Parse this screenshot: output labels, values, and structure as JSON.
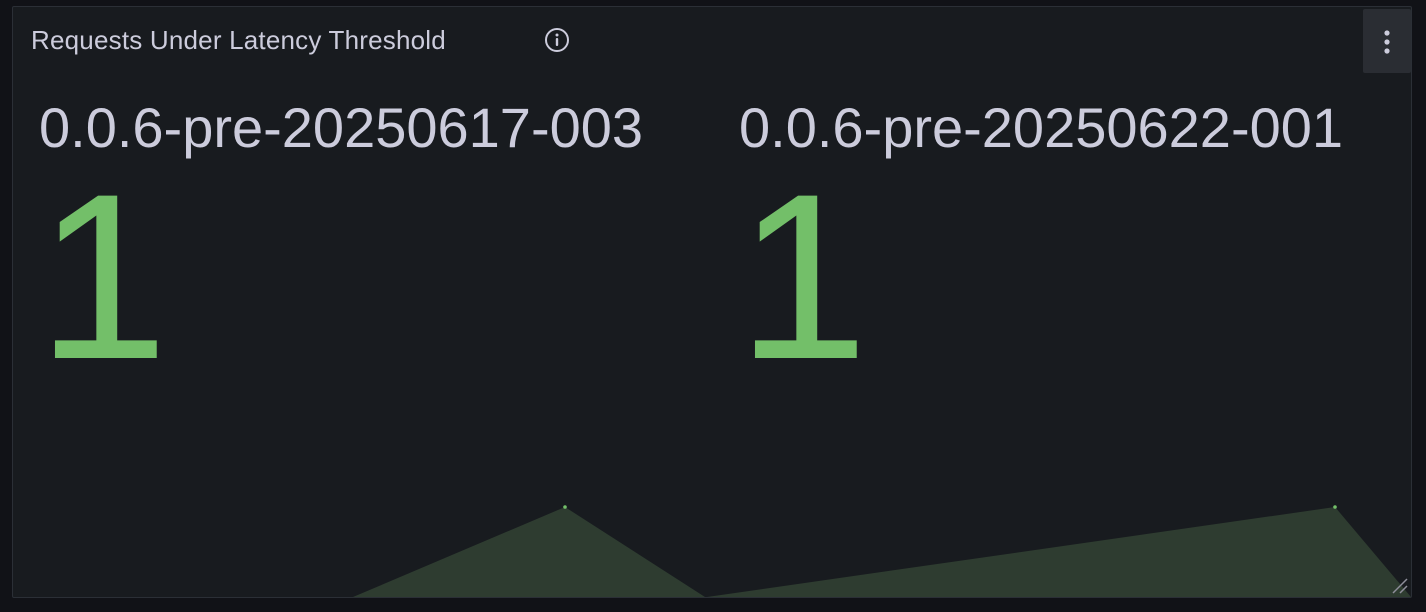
{
  "panel": {
    "title": "Requests Under Latency Threshold",
    "info_icon": "info-icon",
    "menu_icon": "kebab-menu-icon"
  },
  "stats": [
    {
      "label": "0.0.6-pre-20250617-003",
      "value": "1"
    },
    {
      "label": "0.0.6-pre-20250622-001",
      "value": "1"
    }
  ],
  "colors": {
    "value": "#73bf69",
    "sparkline_fill": "#2e3c30",
    "text": "#ccccdc",
    "panel_bg": "#181b1f"
  }
}
